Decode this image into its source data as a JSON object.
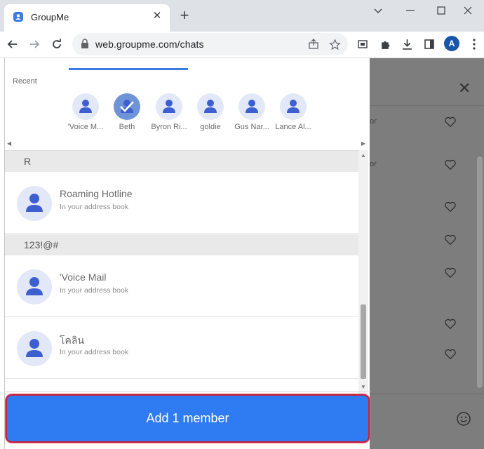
{
  "browser": {
    "tab_title": "GroupMe",
    "tab_close": "✕",
    "new_tab": "+",
    "url": "web.groupme.com/chats",
    "profile_initial": "A"
  },
  "colors": {
    "accent": "#2e7bf2",
    "highlight_border": "#c8203a",
    "avatar_bg": "#e3e8f8",
    "avatar_figure": "#3d5fd0"
  },
  "recent": {
    "label": "Recent",
    "items": [
      {
        "name": "'Voice M...",
        "selected": false
      },
      {
        "name": "Beth",
        "selected": true
      },
      {
        "name": "Byron Ri...",
        "selected": false
      },
      {
        "name": "goldie",
        "selected": false
      },
      {
        "name": "Gus Nar...",
        "selected": false
      },
      {
        "name": "Lance Al...",
        "selected": false
      }
    ]
  },
  "contacts": {
    "sections": [
      {
        "label": "R",
        "items": [
          {
            "name": "Roaming Hotline",
            "subtitle": "In your address book"
          }
        ]
      },
      {
        "label": "123!@#",
        "items": [
          {
            "name": "'Voice Mail",
            "subtitle": "In your address book"
          },
          {
            "name": "โคลิน",
            "subtitle": "In your address book"
          }
        ]
      }
    ]
  },
  "background_chat": {
    "close": "✕",
    "snippets": [
      "or",
      "or"
    ]
  },
  "add_button": {
    "label": "Add 1 member"
  }
}
